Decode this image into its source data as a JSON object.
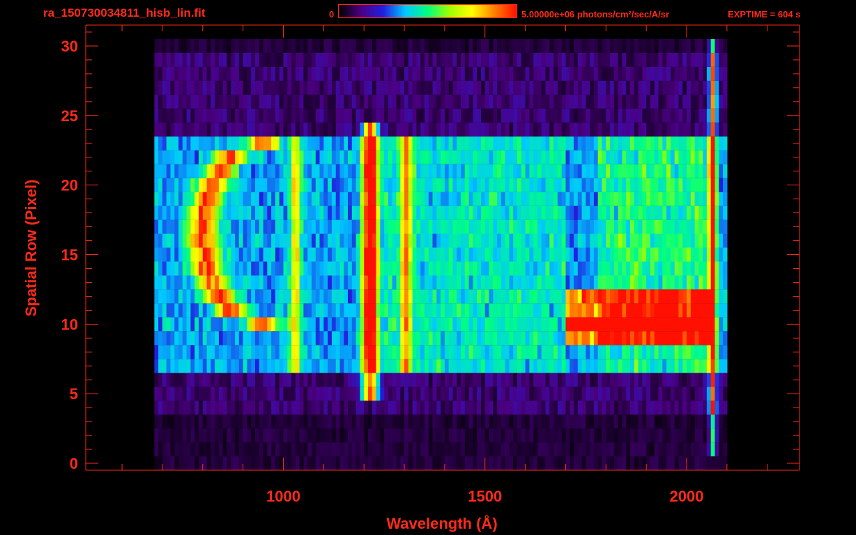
{
  "header": {
    "title": "ra_150730034811_hisb_lin.fit",
    "colorbar_min": "0",
    "colorbar_max_label": "5.00000e+06 photons/cm²/sec/A/sr",
    "exptime": "EXPTIME = 604 s"
  },
  "colors": {
    "text": "#ff2a1a",
    "axis": "#ff2a1a",
    "background": "#000000",
    "colormap": [
      "#000000",
      "#4b0082",
      "#2020e0",
      "#00c8ff",
      "#00ff80",
      "#a0ff00",
      "#ffff00",
      "#ff8000",
      "#ff1000"
    ]
  },
  "chart_data": {
    "type": "heatmap",
    "xlabel": "Wavelength (Å)",
    "ylabel": "Spatial Row (Pixel)",
    "xlim": [
      510,
      2280
    ],
    "ylim": [
      -0.5,
      31.5
    ],
    "x_ticks": [
      1000,
      1500,
      2000
    ],
    "y_ticks": [
      0,
      5,
      10,
      15,
      20,
      25,
      30
    ],
    "colorbar_range": [
      0,
      5000000
    ],
    "rows": 31,
    "data_extent_wavelength": [
      680,
      2100
    ],
    "features": [
      {
        "type": "emission_line",
        "wavelength": 1216,
        "rows": [
          5,
          24
        ],
        "peak_level": 0.9
      },
      {
        "type": "emission_line",
        "wavelength": 1304,
        "rows": [
          7,
          23
        ],
        "peak_level": 0.45
      },
      {
        "type": "emission_line",
        "wavelength": 1030,
        "rows": [
          7,
          23
        ],
        "peak_level": 0.42
      },
      {
        "type": "arc",
        "wavelength_center": 950,
        "rows": [
          10,
          23
        ],
        "peak_level": 0.65
      },
      {
        "type": "continuum_band",
        "wavelength": [
          1700,
          2070
        ],
        "rows": [
          9,
          12
        ],
        "peak_level": 0.85
      },
      {
        "type": "edge",
        "wavelength": 2065,
        "rows": [
          1,
          30
        ],
        "peak_level": 1.0
      }
    ]
  }
}
